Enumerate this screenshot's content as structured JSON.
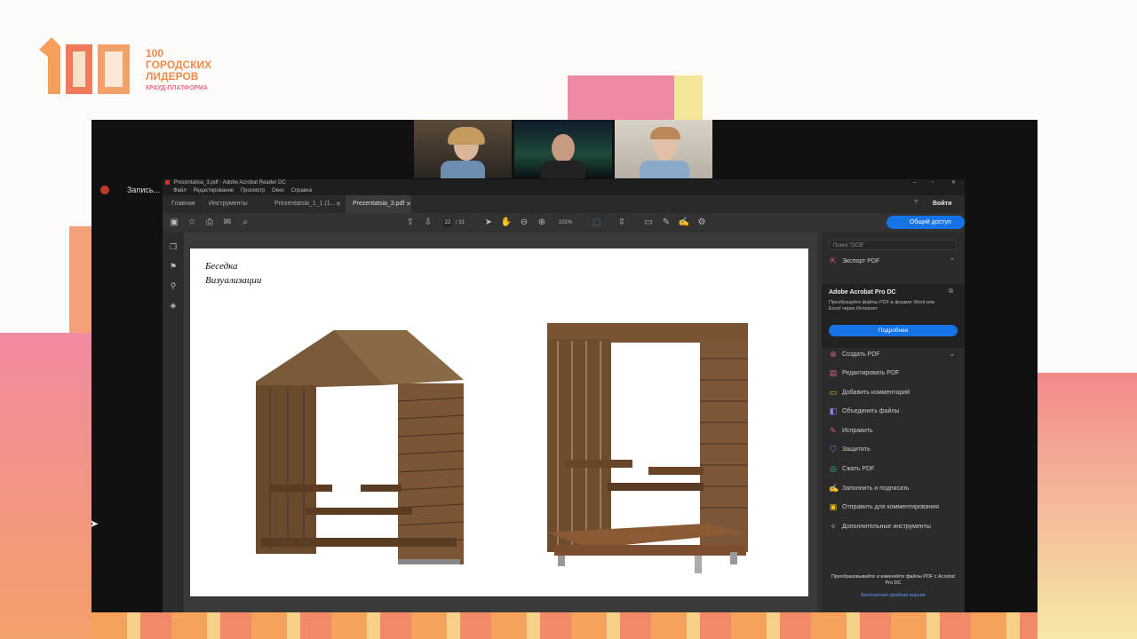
{
  "branding": {
    "logo_line1": "100",
    "logo_line2": "ГОРОДСКИХ",
    "logo_line3": "ЛИДЕРОВ",
    "logo_sub": "КРАУД-ПЛАТФОРМА"
  },
  "recording": {
    "label": "Запись..."
  },
  "acrobat": {
    "window_title": "Prezentatsia_3.pdf - Adobe Acrobat Reader DC",
    "menu": [
      "Файл",
      "Редактирование",
      "Просмотр",
      "Окно",
      "Справка"
    ],
    "tabs": {
      "home": "Главная",
      "tools": "Инструменты",
      "doc1": "Prezentatsia_1_1 (1...",
      "doc2": "Prezentatsia_3.pdf"
    },
    "signin": "Войти",
    "toolbar": {
      "page_current": "22",
      "page_total": "/ 31",
      "zoom": "101%"
    },
    "share_button": "Общий доступ",
    "document": {
      "title_line1": "Беседка",
      "title_line2": "Визуализации"
    },
    "right_panel": {
      "search_placeholder": "Поиск \"ОСВ\"",
      "export_pdf": "Экспорт PDF",
      "promo_title": "Adobe Acrobat Pro DC",
      "promo_text": "Преобразуйте файлы PDF в формат Word или Excel через Интернет",
      "promo_button": "Подробнее",
      "tools": [
        "Создать PDF",
        "Редактировать PDF",
        "Добавить комментарий",
        "Объединить файлы",
        "Исправить",
        "Защитить",
        "Сжать PDF",
        "Заполнить и подписать",
        "Отправить для комментирования",
        "Дополнительные инструменты"
      ],
      "footer": "Преобразовывайте и изменяйте файлы PDF с Acrobat Pro DC",
      "trial_link": "Бесплатная пробная версия"
    }
  },
  "colors": {
    "accent_blue": "#1473e6",
    "brand_orange": "#f08a4b",
    "brand_pink": "#f06a8a"
  }
}
